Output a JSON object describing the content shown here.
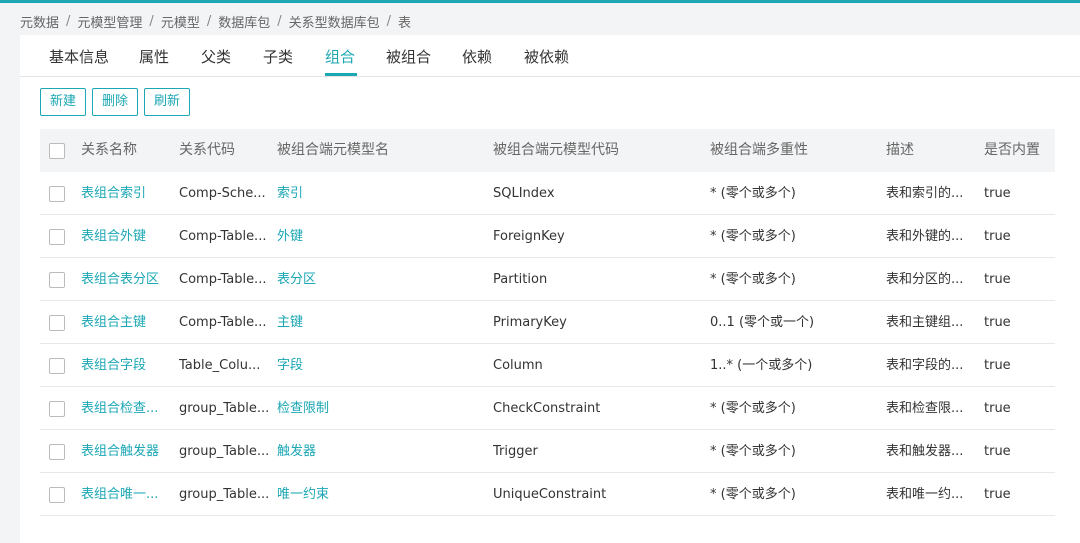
{
  "colors": {
    "accent": "#1ba7b4",
    "background": "#f3f4f6"
  },
  "breadcrumb": [
    "元数据",
    "元模型管理",
    "元模型",
    "数据库包",
    "关系型数据库包",
    "表"
  ],
  "tabs": [
    {
      "label": "基本信息",
      "active": false
    },
    {
      "label": "属性",
      "active": false
    },
    {
      "label": "父类",
      "active": false
    },
    {
      "label": "子类",
      "active": false
    },
    {
      "label": "组合",
      "active": true
    },
    {
      "label": "被组合",
      "active": false
    },
    {
      "label": "依赖",
      "active": false
    },
    {
      "label": "被依赖",
      "active": false
    }
  ],
  "toolbar": {
    "new_label": "新建",
    "delete_label": "删除",
    "refresh_label": "刷新"
  },
  "table": {
    "headers": [
      "关系名称",
      "关系代码",
      "被组合端元模型名",
      "被组合端元模型代码",
      "被组合端多重性",
      "描述",
      "是否内置"
    ],
    "rows": [
      {
        "name": "表组合索引",
        "code": "Comp-Sche...",
        "target_name": "索引",
        "target_code": "SQLIndex",
        "multiplicity": "* (零个或多个)",
        "desc": "表和索引的...",
        "builtin": "true"
      },
      {
        "name": "表组合外键",
        "code": "Comp-Table...",
        "target_name": "外键",
        "target_code": "ForeignKey",
        "multiplicity": "* (零个或多个)",
        "desc": "表和外键的...",
        "builtin": "true"
      },
      {
        "name": "表组合表分区",
        "code": "Comp-Table...",
        "target_name": "表分区",
        "target_code": "Partition",
        "multiplicity": "* (零个或多个)",
        "desc": "表和分区的...",
        "builtin": "true"
      },
      {
        "name": "表组合主键",
        "code": "Comp-Table...",
        "target_name": "主键",
        "target_code": "PrimaryKey",
        "multiplicity": "0..1 (零个或一个)",
        "desc": "表和主键组...",
        "builtin": "true"
      },
      {
        "name": "表组合字段",
        "code": "Table_Colu...",
        "target_name": "字段",
        "target_code": "Column",
        "multiplicity": "1..* (一个或多个)",
        "desc": "表和字段的...",
        "builtin": "true"
      },
      {
        "name": "表组合检查...",
        "code": "group_Table...",
        "target_name": "检查限制",
        "target_code": "CheckConstraint",
        "multiplicity": "* (零个或多个)",
        "desc": "表和检查限...",
        "builtin": "true"
      },
      {
        "name": "表组合触发器",
        "code": "group_Table...",
        "target_name": "触发器",
        "target_code": "Trigger",
        "multiplicity": "* (零个或多个)",
        "desc": "表和触发器...",
        "builtin": "true"
      },
      {
        "name": "表组合唯一...",
        "code": "group_Table...",
        "target_name": "唯一约束",
        "target_code": "UniqueConstraint",
        "multiplicity": "* (零个或多个)",
        "desc": "表和唯一约...",
        "builtin": "true"
      }
    ]
  }
}
